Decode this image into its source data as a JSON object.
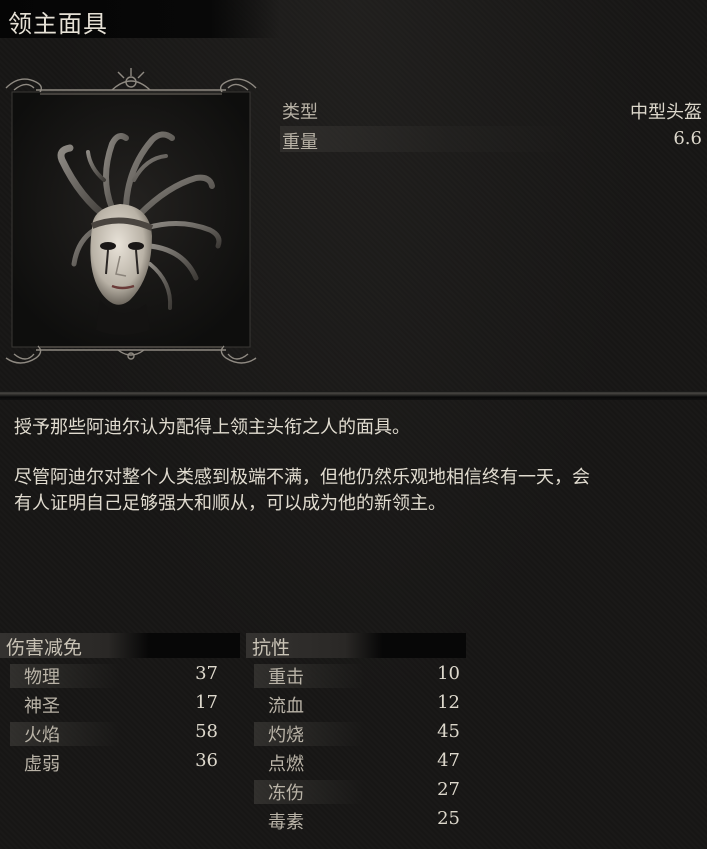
{
  "item": {
    "name": "领主面具",
    "icon": "lord-mask-helmet-icon"
  },
  "attributes": [
    {
      "label": "类型",
      "value": "中型头盔"
    },
    {
      "label": "重量",
      "value": "6.6"
    }
  ],
  "description": {
    "line1": "授予那些阿迪尔认为配得上领主头衔之人的面具。",
    "para2_line1": "尽管阿迪尔对整个人类感到极端不满，但他仍然乐观地相信终有一天，会",
    "para2_line2": "有人证明自己足够强大和顺从，可以成为他的新领主。"
  },
  "damage_reduction": {
    "title": "伤害减免",
    "rows": [
      {
        "name": "物理",
        "value": "37"
      },
      {
        "name": "神圣",
        "value": "17"
      },
      {
        "name": "火焰",
        "value": "58"
      },
      {
        "name": "虚弱",
        "value": "36"
      }
    ]
  },
  "resistance": {
    "title": "抗性",
    "rows": [
      {
        "name": "重击",
        "value": "10"
      },
      {
        "name": "流血",
        "value": "12"
      },
      {
        "name": "灼烧",
        "value": "45"
      },
      {
        "name": "点燃",
        "value": "47"
      },
      {
        "name": "冻伤",
        "value": "27"
      },
      {
        "name": "毒素",
        "value": "25"
      }
    ]
  }
}
